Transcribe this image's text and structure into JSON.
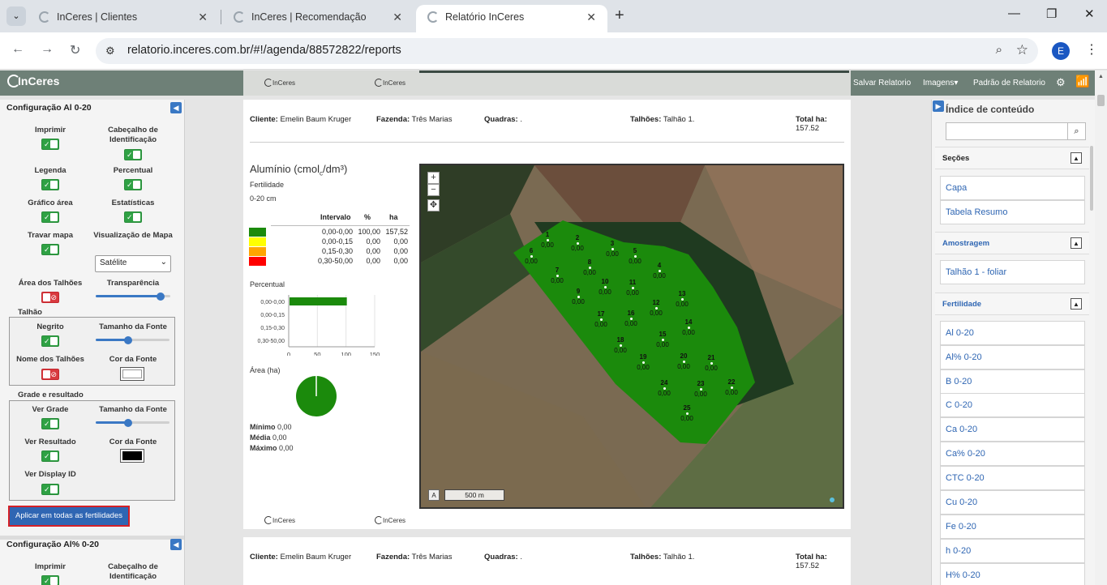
{
  "browser": {
    "tabs": [
      {
        "title": "InCeres | Clientes"
      },
      {
        "title": "InCeres | Recomendação"
      },
      {
        "title": "Relatório InCeres"
      }
    ],
    "url": "relatorio.inceres.com.br/#!/agenda/88572822/reports",
    "profile_initial": "E"
  },
  "header": {
    "logo_text": "InCeres",
    "strip_logo": "InCeres",
    "links": [
      "Salvar Relatorio",
      "Imagens",
      "Padrão de Relatorio"
    ]
  },
  "config_panel": {
    "title": "Configuração Al 0-20",
    "options": {
      "imprimir": "Imprimir",
      "cabecalho": "Cabeçalho de Identificação",
      "legenda": "Legenda",
      "percentual": "Percentual",
      "grafico_area": "Gráfico área",
      "estatisticas": "Estatísticas",
      "travar_mapa": "Travar mapa",
      "visualizacao": "Visualização de Mapa",
      "satelite": "Satélite",
      "area_talhoes": "Área dos Talhões",
      "transparencia": "Transparência"
    },
    "talhao": {
      "title": "Talhão",
      "negrito": "Negrito",
      "tamanho_fonte": "Tamanho da Fonte",
      "nome_talhoes": "Nome dos Talhões",
      "cor_fonte": "Cor da Fonte"
    },
    "grade": {
      "title": "Grade e resultado",
      "ver_grade": "Ver Grade",
      "tamanho_fonte": "Tamanho da Fonte",
      "ver_resultado": "Ver Resultado",
      "cor_fonte": "Cor da Fonte",
      "ver_display": "Ver Display ID"
    },
    "apply_button": "Aplicar em todas as fertilidades",
    "next_title": "Configuração Al% 0-20",
    "next_imprimir": "Imprimir",
    "next_cabecalho": "Cabeçalho de Identificação"
  },
  "report": {
    "cliente_label": "Cliente:",
    "cliente": "Emelin Baum Kruger",
    "fazenda_label": "Fazenda:",
    "fazenda": "Três Marias",
    "quadras_label": "Quadras:",
    "quadras": ".",
    "talhoes_label": "Talhões:",
    "talhoes": "Talhão 1.",
    "total_label": "Total ha:",
    "total": "157.52",
    "title_main": "Alumínio (cmol",
    "title_sub": "c",
    "title_end": "/dm³)",
    "fertilidade": "Fertilidade",
    "profundidade": "0-20 cm",
    "legend_headers": [
      "Intervalo",
      "%",
      "ha"
    ],
    "legend_rows": [
      {
        "color": "#1b8a0c",
        "intervalo": "0,00-0,00",
        "pct": "100,00",
        "ha": "157,52"
      },
      {
        "color": "#ffff00",
        "intervalo": "0,00-0,15",
        "pct": "0,00",
        "ha": "0,00"
      },
      {
        "color": "#ffa500",
        "intervalo": "0,15-0,30",
        "pct": "0,00",
        "ha": "0,00"
      },
      {
        "color": "#ff0000",
        "intervalo": "0,30-50,00",
        "pct": "0,00",
        "ha": "0,00"
      }
    ],
    "percentual": "Percentual",
    "area_ha": "Área (ha)",
    "minimo_label": "Mínimo",
    "minimo": "0,00",
    "media_label": "Média",
    "media": "0,00",
    "maximo_label": "Máximo",
    "maximo": "0,00",
    "scale": "500 m",
    "scale_a": "A",
    "footer_logo": "InCeres"
  },
  "chart_data": [
    {
      "type": "bar",
      "title": "Percentual",
      "orientation": "horizontal",
      "categories": [
        "0,00-0,00",
        "0,00-0,15",
        "0,15-0,30",
        "0,30-50,00"
      ],
      "values": [
        100,
        0,
        0,
        0
      ],
      "xlim": [
        0,
        150
      ],
      "xticks": [
        "0",
        "50",
        "100",
        "150"
      ],
      "colors": [
        "#1b8a0c"
      ]
    },
    {
      "type": "pie",
      "title": "Área (ha)",
      "categories": [
        "0,00-0,00",
        "0,00-0,15",
        "0,15-0,30",
        "0,30-50,00"
      ],
      "values": [
        157.52,
        0,
        0,
        0
      ],
      "colors": [
        "#1b8a0c",
        "#ffff00",
        "#ffa500",
        "#ff0000"
      ]
    }
  ],
  "map_points": [
    {
      "id": "1",
      "value": "0,00"
    },
    {
      "id": "2",
      "value": "0,00"
    },
    {
      "id": "3",
      "value": "0,00"
    },
    {
      "id": "4",
      "value": "0,00"
    },
    {
      "id": "5",
      "value": "0,00"
    },
    {
      "id": "6",
      "value": "0,00"
    },
    {
      "id": "7",
      "value": "0,00"
    },
    {
      "id": "8",
      "value": "0,00"
    },
    {
      "id": "9",
      "value": "0,00"
    },
    {
      "id": "10",
      "value": "0,00"
    },
    {
      "id": "11",
      "value": "0,00"
    },
    {
      "id": "12",
      "value": "0,00"
    },
    {
      "id": "13",
      "value": "0,00"
    },
    {
      "id": "14",
      "value": "0,00"
    },
    {
      "id": "15",
      "value": "0,00"
    },
    {
      "id": "16",
      "value": "0,00"
    },
    {
      "id": "17",
      "value": "0,00"
    },
    {
      "id": "18",
      "value": "0,00"
    },
    {
      "id": "19",
      "value": "0,00"
    },
    {
      "id": "20",
      "value": "0,00"
    },
    {
      "id": "21",
      "value": "0,00"
    },
    {
      "id": "22",
      "value": "0,00"
    },
    {
      "id": "23",
      "value": "0,00"
    },
    {
      "id": "24",
      "value": "0,00"
    },
    {
      "id": "25",
      "value": "0,00"
    }
  ],
  "toc": {
    "title": "Índice de conteúdo",
    "search_placeholder": "",
    "sections": [
      {
        "label": "Seções",
        "items": [
          "Capa",
          "Tabela Resumo"
        ]
      },
      {
        "label": "Amostragem",
        "items": [
          "Talhão 1 - foliar"
        ]
      },
      {
        "label": "Fertilidade",
        "items": [
          "Al 0-20",
          "Al% 0-20",
          "B 0-20",
          "C 0-20",
          "Ca 0-20",
          "Ca% 0-20",
          "CTC 0-20",
          "Cu 0-20",
          "Fe 0-20",
          "h 0-20",
          "H% 0-20"
        ]
      }
    ]
  }
}
